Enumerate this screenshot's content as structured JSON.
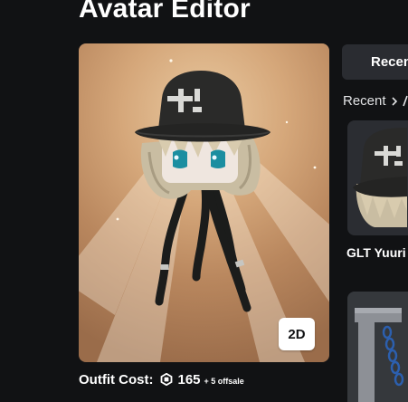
{
  "header": {
    "title": "Avatar Editor"
  },
  "preview": {
    "view_toggle_label": "2D"
  },
  "outfit_cost": {
    "label": "Outfit Cost:",
    "currency_icon": "robux-icon",
    "value": "165",
    "offsale_note": "+ 5 offsale"
  },
  "tabs": {
    "active_label": "Recent"
  },
  "breadcrumb": {
    "items": [
      "Recent"
    ],
    "separator_icon": "chevron-right-icon"
  },
  "items": [
    {
      "name": "GLT Yuuri",
      "thumbnail_icon": "bucket-hat-hair-icon"
    },
    {
      "name": "",
      "thumbnail_icon": "chain-accessory-icon"
    }
  ]
}
